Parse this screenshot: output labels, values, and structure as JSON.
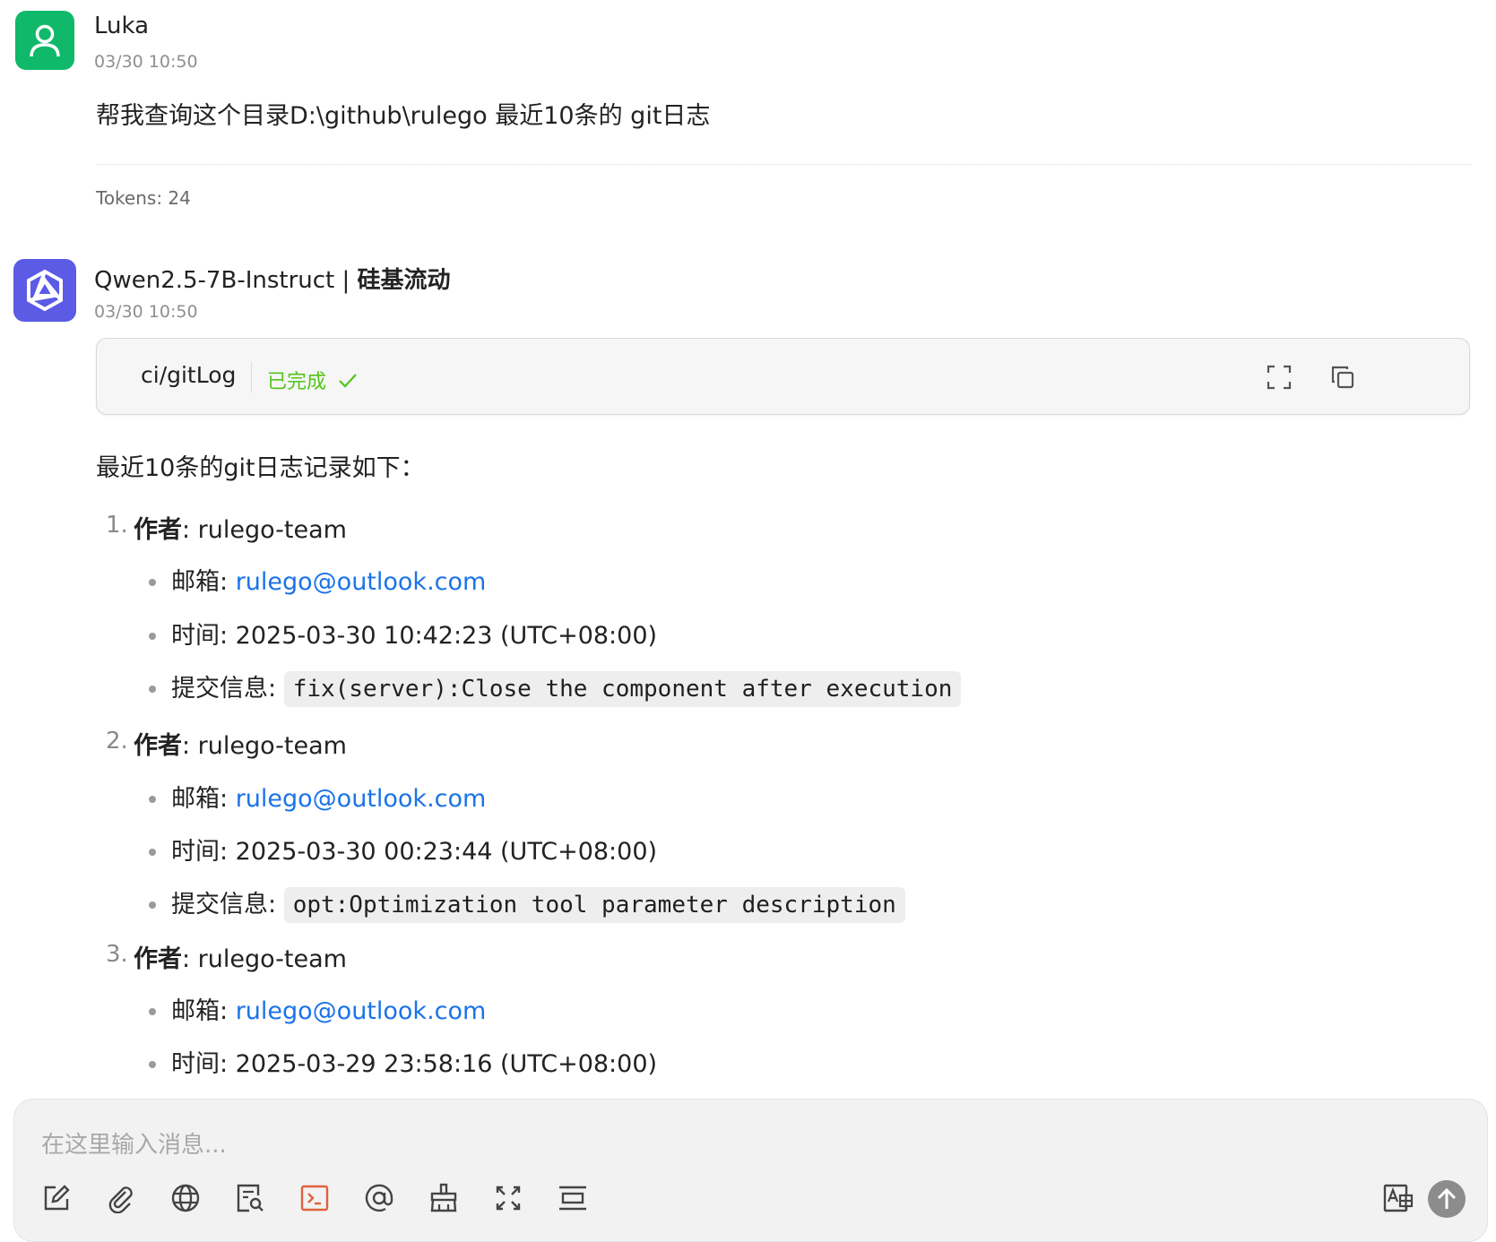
{
  "user_message": {
    "sender": "Luka",
    "time": "03/30 10:50",
    "text": "帮我查询这个目录D:\\github\\rulego 最近10条的 git日志",
    "tokens": "Tokens: 24"
  },
  "assistant_message": {
    "model": "Qwen2.5-7B-Instruct",
    "separator": " | ",
    "provider": "硅基流动",
    "time": "03/30 10:50",
    "tool_call": {
      "name": "ci/gitLog",
      "status": "已完成",
      "status_icon": "check-icon",
      "status_color": "#52c41a"
    },
    "intro": "最近10条的git日志记录如下：",
    "entries": [
      {
        "num": "1.",
        "author_label": "作者",
        "author": ": rulego-team",
        "email_label": "邮箱: ",
        "email": "rulego@outlook.com",
        "time_text": "时间: 2025-03-30 10:42:23 (UTC+08:00)",
        "commit_label": "提交信息: ",
        "commit": "fix(server):Close the component after execution"
      },
      {
        "num": "2.",
        "author_label": "作者",
        "author": ": rulego-team",
        "email_label": "邮箱: ",
        "email": "rulego@outlook.com",
        "time_text": "时间: 2025-03-30 00:23:44 (UTC+08:00)",
        "commit_label": "提交信息: ",
        "commit": "opt:Optimization tool parameter description"
      },
      {
        "num": "3.",
        "author_label": "作者",
        "author": ": rulego-team",
        "email_label": "邮箱: ",
        "email": "rulego@outlook.com",
        "time_text": "时间: 2025-03-29 23:58:16 (UTC+08:00)"
      }
    ]
  },
  "input": {
    "placeholder": "在这里输入消息..."
  },
  "toolbar_icons": [
    "edit-icon",
    "attachment-icon",
    "globe-icon",
    "knowledge-search-icon",
    "terminal-icon",
    "mention-icon",
    "clear-broom-icon",
    "expand-icon",
    "wrap-lines-icon"
  ],
  "colors": {
    "user_avatar": "#10b96a",
    "bot_avatar": "#5b5be6",
    "link": "#1a73e8",
    "terminal_icon_active": "#e0623a",
    "send_button": "#8c8c8c"
  }
}
